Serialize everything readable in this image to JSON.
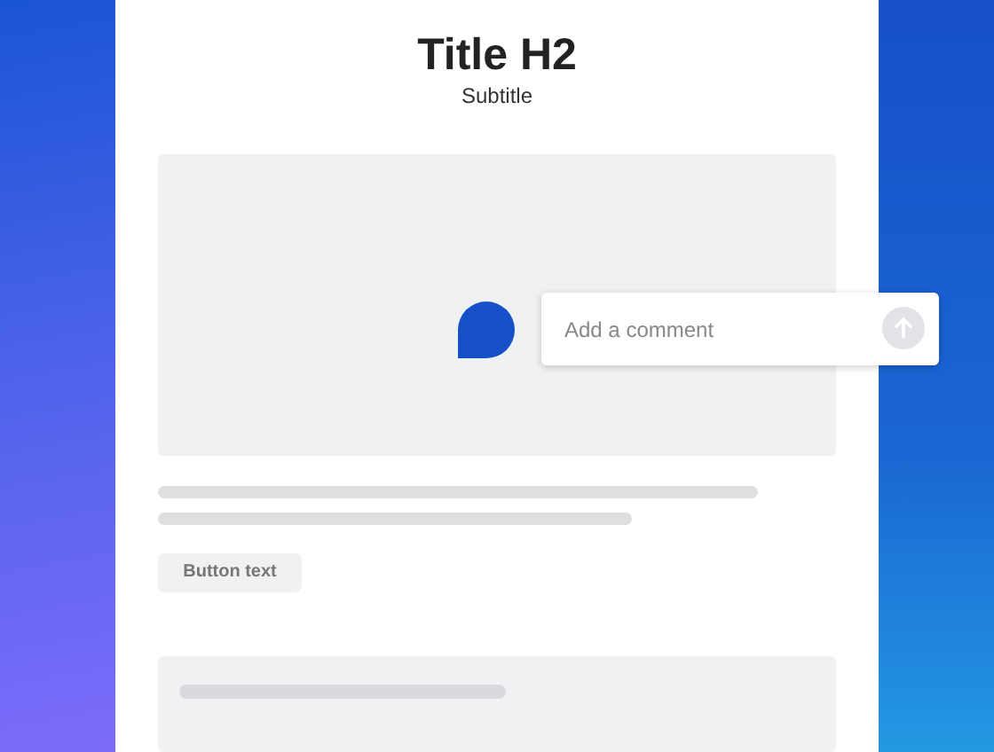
{
  "page": {
    "title": "Title H2",
    "subtitle": "Subtitle"
  },
  "comment": {
    "placeholder": "Add a comment"
  },
  "button": {
    "label": "Button text"
  }
}
